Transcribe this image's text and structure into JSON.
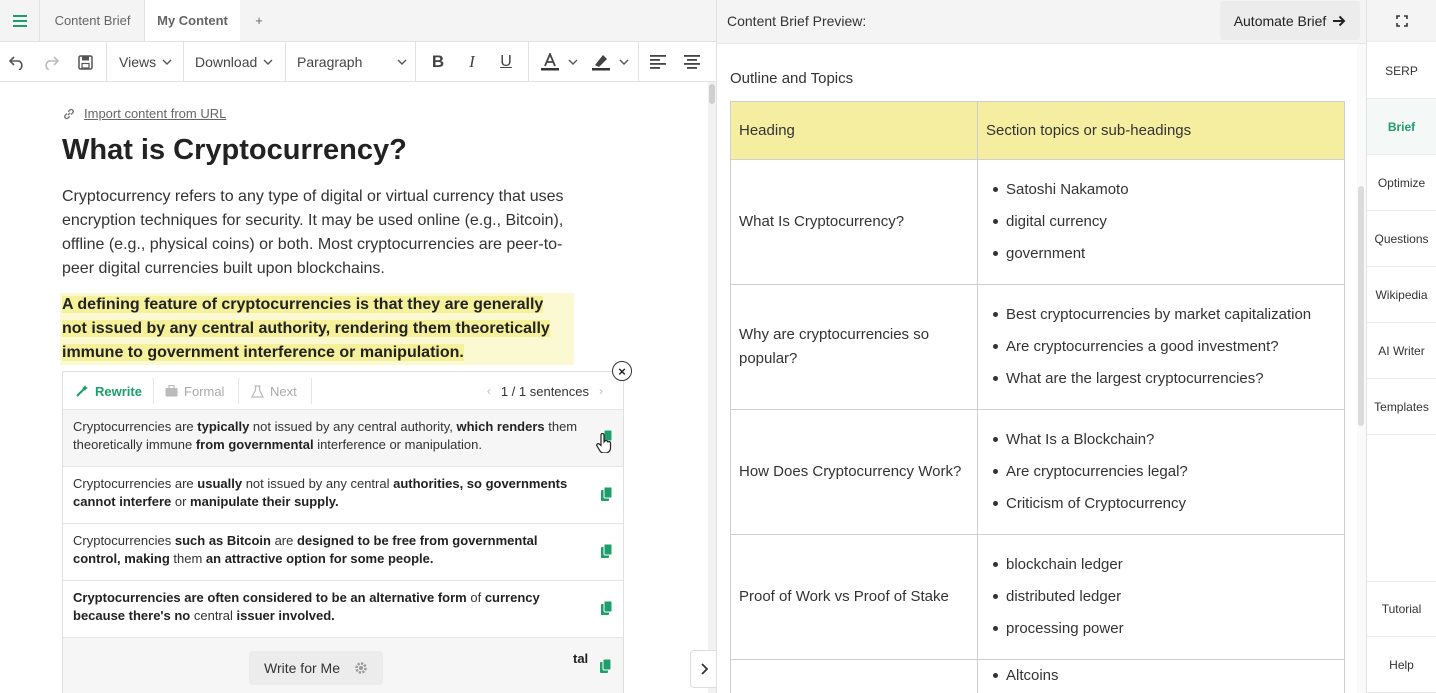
{
  "tabs": {
    "content_brief": "Content Brief",
    "my_content": "My Content",
    "add": "+"
  },
  "toolbar": {
    "views": "Views",
    "download": "Download",
    "paragraph": "Paragraph"
  },
  "editor": {
    "import_link": "Import content from URL",
    "title": "What is Cryptocurrency?",
    "paragraph1": "Cryptocurrency refers to any type of digital or virtual currency that uses encryption techniques for security. It may be used online (e.g., Bitcoin), offline (e.g., physical coins) or both. Most cryptocurrencies are peer-to-peer digital currencies built upon blockchains.",
    "paragraph2": "A defining feature of cryptocurrencies is that they are generally not issued by any central authority, rendering them theoretically immune to government interference or manipulation."
  },
  "rewrite_panel": {
    "rewrite": "Rewrite",
    "formal": "Formal",
    "next": "Next",
    "counter": "1 / 1 sentences",
    "suggestions": [
      [
        {
          "t": "Cryptocurrencies are ",
          "b": false
        },
        {
          "t": "typically",
          "b": true
        },
        {
          "t": " not issued by any central authority, ",
          "b": false
        },
        {
          "t": "which renders",
          "b": true
        },
        {
          "t": " them theoretically immune ",
          "b": false
        },
        {
          "t": "from governmental",
          "b": true
        },
        {
          "t": " interference or manipulation.",
          "b": false
        }
      ],
      [
        {
          "t": "Cryptocurrencies are ",
          "b": false
        },
        {
          "t": "usually",
          "b": true
        },
        {
          "t": " not issued by any central ",
          "b": false
        },
        {
          "t": "authorities, so governments cannot interfere",
          "b": true
        },
        {
          "t": " or ",
          "b": false
        },
        {
          "t": "manipulate their supply.",
          "b": true
        }
      ],
      [
        {
          "t": "Cryptocurrencies ",
          "b": false
        },
        {
          "t": "such as Bitcoin",
          "b": true
        },
        {
          "t": " are ",
          "b": false
        },
        {
          "t": "designed to be free from governmental control, making",
          "b": true
        },
        {
          "t": " them ",
          "b": false
        },
        {
          "t": "an attractive option for some people.",
          "b": true
        }
      ],
      [
        {
          "t": "Cryptocurrencies are often considered to be an alternative form",
          "b": true
        },
        {
          "t": " of ",
          "b": false
        },
        {
          "t": "currency because there's no",
          "b": true
        },
        {
          "t": " central ",
          "b": false
        },
        {
          "t": "issuer involved.",
          "b": true
        }
      ]
    ],
    "write_for_me": "Write for Me",
    "trailing_text": "tal",
    "close": "×"
  },
  "preview": {
    "title": "Content Brief Preview:",
    "automate": "Automate Brief",
    "outline_title": "Outline and Topics",
    "table_headers": [
      "Heading",
      "Section topics or sub-headings"
    ],
    "rows": [
      {
        "heading": "What Is Cryptocurrency?",
        "topics": [
          "Satoshi Nakamoto",
          "digital currency",
          "government"
        ]
      },
      {
        "heading": "Why are cryptocurrencies so popular?",
        "topics": [
          "Best cryptocurrencies by market capitalization",
          "Are cryptocurrencies a good investment?",
          "What are the largest cryptocurrencies?"
        ]
      },
      {
        "heading": "How Does Cryptocurrency Work?",
        "topics": [
          "What Is a Blockchain?",
          "Are cryptocurrencies legal?",
          "Criticism of Cryptocurrency"
        ]
      },
      {
        "heading": "Proof of Work vs Proof of Stake",
        "topics": [
          "blockchain ledger",
          "distributed ledger",
          "processing power"
        ]
      },
      {
        "heading": "",
        "topics": [
          "Altcoins"
        ]
      }
    ]
  },
  "sidebar": {
    "items": [
      "SERP",
      "Brief",
      "Optimize",
      "Questions",
      "Wikipedia",
      "AI Writer",
      "Templates"
    ],
    "tutorial": "Tutorial",
    "help": "Help",
    "active": "Brief"
  },
  "colors": {
    "accent": "#1e9e6a",
    "highlight": "#f5f09a",
    "table_header": "#f5eea1"
  }
}
